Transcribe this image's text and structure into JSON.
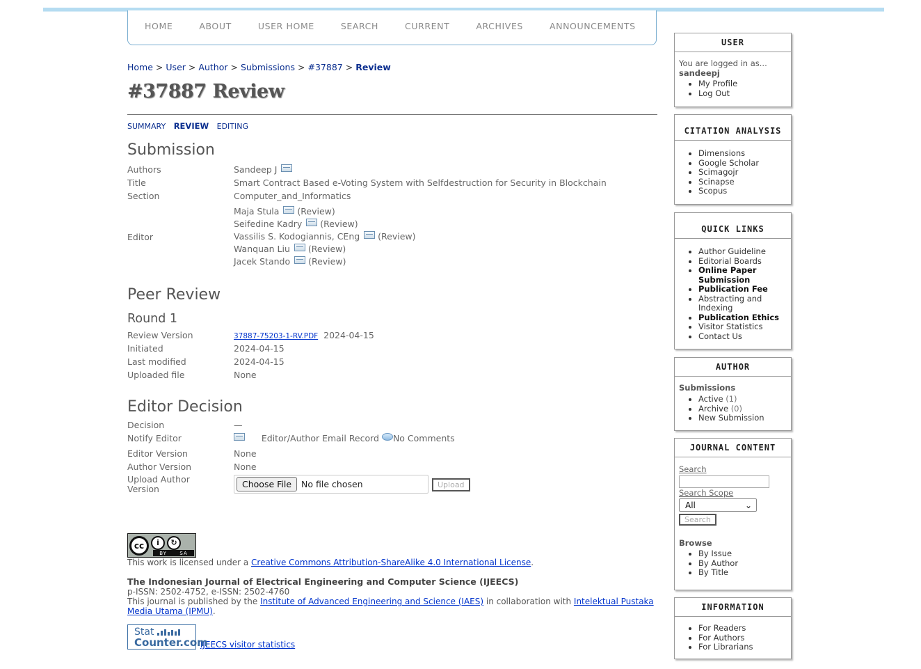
{
  "nav": [
    "HOME",
    "ABOUT",
    "USER HOME",
    "SEARCH",
    "CURRENT",
    "ARCHIVES",
    "ANNOUNCEMENTS"
  ],
  "breadcrumb": {
    "items": [
      "Home",
      "User",
      "Author",
      "Submissions",
      "#37887"
    ],
    "current": "Review",
    "separator": ">"
  },
  "page_title": "#37887 Review",
  "subtabs": {
    "summary": "SUMMARY",
    "review": "REVIEW",
    "editing": "EDITING"
  },
  "submission": {
    "heading": "Submission",
    "authors_label": "Authors",
    "authors_value": "Sandeep J",
    "title_label": "Title",
    "title_value": "Smart Contract Based e-Voting System with Selfdestruction for Security in Blockchain",
    "section_label": "Section",
    "section_value": "Computer_and_Informatics",
    "editor_label": "Editor",
    "editors": [
      {
        "name": "Maja Stula",
        "role": "(Review)"
      },
      {
        "name": "Seifedine Kadry",
        "role": "(Review)"
      },
      {
        "name": "Vassilis S. Kodogiannis, CEng",
        "role": "(Review)"
      },
      {
        "name": "Wanquan Liu",
        "role": "(Review)"
      },
      {
        "name": "Jacek Stando",
        "role": "(Review)"
      }
    ]
  },
  "peer_review": {
    "heading": "Peer Review",
    "round": "Round 1",
    "review_version_label": "Review Version",
    "review_version_file": "37887-75203-1-RV.PDF",
    "review_version_date": "2024-04-15",
    "initiated_label": "Initiated",
    "initiated_value": "2024-04-15",
    "last_modified_label": "Last modified",
    "last_modified_value": "2024-04-15",
    "uploaded_file_label": "Uploaded file",
    "uploaded_file_value": "None"
  },
  "editor_decision": {
    "heading": "Editor Decision",
    "decision_label": "Decision",
    "decision_value": "—",
    "notify_label": "Notify Editor",
    "email_record": "Editor/Author Email Record",
    "no_comments": "No Comments",
    "editor_version_label": "Editor Version",
    "editor_version_value": "None",
    "author_version_label": "Author Version",
    "author_version_value": "None",
    "upload_label": "Upload Author Version",
    "choose_file": "Choose File",
    "no_file": "No file chosen",
    "upload_button": "Upload"
  },
  "footer": {
    "cc_by": "BY",
    "cc_sa": "SA",
    "license_prefix": "This work is licensed under a ",
    "license_link": "Creative Commons Attribution-ShareAlike 4.0 International License",
    "license_suffix": ".",
    "journal_name": "The Indonesian Journal of Electrical Engineering and Computer Science (IJEECS)",
    "issn": "p-ISSN: 2502-4752, e-ISSN: 2502-4760",
    "published_prefix": "This journal is published by the ",
    "publisher_link": "Institute of Advanced Engineering and Science (IAES)",
    "collab": " in collaboration with ",
    "collab_link": "Intelektual Pustaka Media Utama (IPMU)",
    "collab_suffix": ".",
    "statcounter_top": "Stat",
    "statcounter_bottom": "Counter.com",
    "stats_link": "IJEECS visitor statistics"
  },
  "sidebar": {
    "user": {
      "title": "USER",
      "logged_in_as": "You are logged in as...",
      "username": "sandeepj",
      "links": [
        "My Profile",
        "Log Out"
      ]
    },
    "citation": {
      "title": "CITATION ANALYSIS",
      "links": [
        "Dimensions",
        "Google Scholar",
        "Scimagojr",
        "Scinapse",
        "Scopus"
      ]
    },
    "quick_links": {
      "title": "QUICK LINKS",
      "links": [
        "Author Guideline",
        "Editorial Boards",
        "Online Paper Submission",
        "Publication Fee",
        "Abstracting and Indexing",
        "Publication Ethics",
        "Visitor Statistics",
        "Contact Us"
      ]
    },
    "author": {
      "title": "AUTHOR",
      "sub": "Submissions",
      "active": "Active",
      "active_count": "(1)",
      "archive": "Archive",
      "archive_count": "(0)",
      "new_submission": "New Submission"
    },
    "journal_content": {
      "title": "JOURNAL CONTENT",
      "search_label": "Search",
      "scope_label": "Search Scope",
      "scope_value": "All",
      "search_button": "Search",
      "browse_label": "Browse",
      "browse_links": [
        "By Issue",
        "By Author",
        "By Title"
      ]
    },
    "information": {
      "title": "INFORMATION",
      "links": [
        "For Readers",
        "For Authors",
        "For Librarians"
      ]
    }
  }
}
